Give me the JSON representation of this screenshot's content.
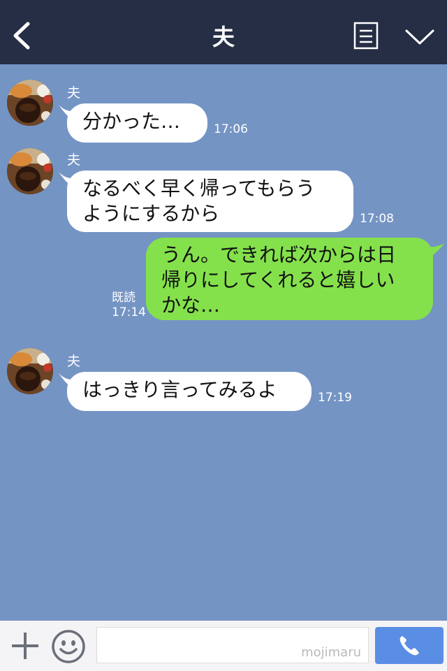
{
  "header": {
    "title": "夫",
    "back_icon": "chevron-left-icon",
    "note_icon": "note-icon",
    "menu_icon": "chevron-down-icon",
    "bg_color": "#252e45"
  },
  "chat": {
    "bg_color": "#7494c4",
    "messages": [
      {
        "sender": "夫",
        "text": "分かった…",
        "time": "17:06"
      },
      {
        "sender": "夫",
        "text": "なるべく早く帰ってもらう\nようにするから",
        "time": "17:08"
      },
      {
        "text": "うん。できれば次からは日\n帰りにしてくれると嬉しい\nかな…",
        "read": "既読",
        "time": "17:14"
      },
      {
        "sender": "夫",
        "text": "はっきり言ってみるよ",
        "time": "17:19"
      }
    ],
    "incoming_color": "#ffffff",
    "outgoing_color": "#84e14c"
  },
  "footer": {
    "plus_icon": "plus-icon",
    "emoji_icon": "smiley-icon",
    "input_value": "",
    "watermark": "mojimaru",
    "call_icon": "phone-icon",
    "call_color": "#5a8ee5"
  }
}
